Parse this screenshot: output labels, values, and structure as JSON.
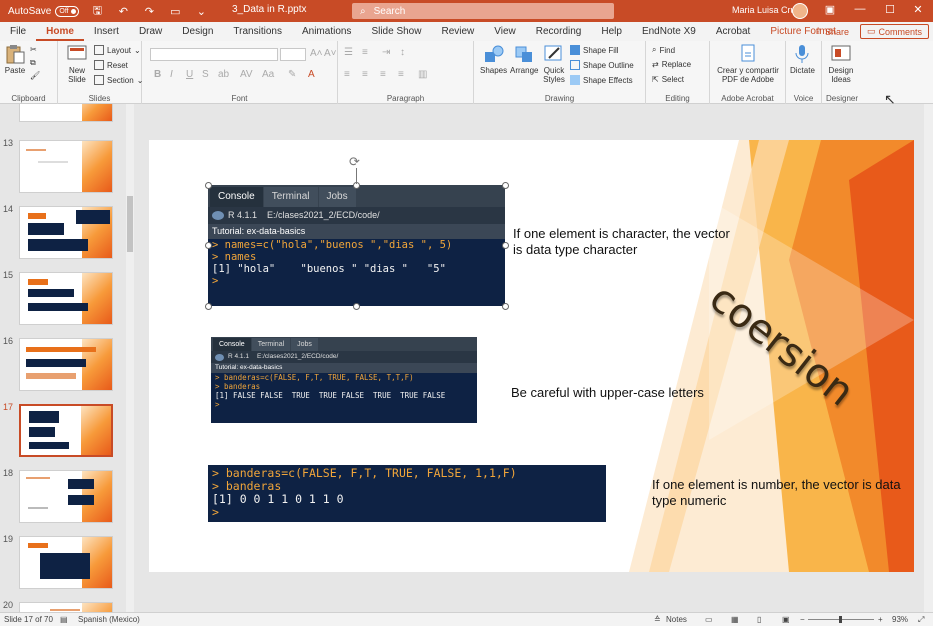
{
  "titlebar": {
    "autosave_label": "AutoSave",
    "autosave_state": "Off",
    "doc_name": "3_Data in R.pptx",
    "search_placeholder": "Search",
    "user_name": "Maria Luisa Cruz",
    "bg_color": "#c84b26"
  },
  "menu": {
    "tabs": [
      "File",
      "Home",
      "Insert",
      "Draw",
      "Design",
      "Transitions",
      "Animations",
      "Slide Show",
      "Review",
      "View",
      "Recording",
      "Help",
      "EndNote X9",
      "Acrobat",
      "Picture Format"
    ],
    "active": "Home",
    "share_label": "Share",
    "comments_label": "Comments"
  },
  "ribbon": {
    "clipboard": {
      "paste": "Paste",
      "label": "Clipboard"
    },
    "slides": {
      "new_slide": "New Slide",
      "layout": "Layout",
      "reset": "Reset",
      "section": "Section",
      "label": "Slides"
    },
    "font": {
      "label": "Font"
    },
    "paragraph": {
      "label": "Paragraph"
    },
    "drawing": {
      "shapes": "Shapes",
      "arrange": "Arrange",
      "quick_styles": "Quick Styles",
      "shape_fill": "Shape Fill",
      "shape_outline": "Shape Outline",
      "shape_effects": "Shape Effects",
      "label": "Drawing"
    },
    "editing": {
      "find": "Find",
      "replace": "Replace",
      "select": "Select",
      "label": "Editing"
    },
    "acrobat": {
      "create_pdf": "Crear y compartir PDF de Adobe",
      "label": "Adobe Acrobat"
    },
    "voice": {
      "dictate": "Dictate",
      "label": "Voice"
    },
    "designer": {
      "design_ideas": "Design Ideas",
      "label": "Designer"
    }
  },
  "thumbnails": {
    "numbers": [
      "13",
      "14",
      "15",
      "16",
      "17",
      "18",
      "19",
      "20"
    ],
    "selected": "17"
  },
  "slide": {
    "console1": {
      "tabs": [
        "Console",
        "Terminal",
        "Jobs"
      ],
      "r_version": "R 4.1.1",
      "path": "E:/clases2021_2/ECD/code/",
      "tutorial": "Tutorial: ex-data-basics",
      "lines": [
        {
          "prompt": "> ",
          "text": "names=c(\"hola\",\"buenos \",\"dias \", 5)"
        },
        {
          "prompt": "> ",
          "text": "names"
        },
        {
          "prompt": "",
          "text": "[1] \"hola\"    \"buenos \" \"dias \"   \"5\""
        },
        {
          "prompt": "> ",
          "text": ""
        }
      ]
    },
    "text1": "If one element is character, the vector is data type character",
    "console2": {
      "tabs": [
        "Console",
        "Terminal",
        "Jobs"
      ],
      "r_version": "R 4.1.1",
      "path": "E:/clases2021_2/ECD/code/",
      "tutorial": "Tutorial: ex-data-basics",
      "lines": [
        {
          "prompt": "> ",
          "text": "banderas=c(FALSE, F,T, TRUE, FALSE, T,T,F)"
        },
        {
          "prompt": "> ",
          "text": "banderas"
        },
        {
          "prompt": "",
          "text": "[1] FALSE FALSE  TRUE  TRUE FALSE  TRUE  TRUE FALSE"
        },
        {
          "prompt": "> ",
          "text": ""
        }
      ]
    },
    "text2": "Be careful with upper-case letters",
    "console3": {
      "lines": [
        {
          "prompt": "> ",
          "text": "banderas=c(FALSE, F,T, TRUE, FALSE, 1,1,F)"
        },
        {
          "prompt": "> ",
          "text": "banderas"
        },
        {
          "prompt": "",
          "text": "[1] 0 0 1 1 0 1 1 0"
        },
        {
          "prompt": "> ",
          "text": ""
        }
      ]
    },
    "text3": "If one element is number, the vector is data type numeric",
    "wordart": "coersion"
  },
  "statusbar": {
    "slide_of": "Slide 17 of 70",
    "language": "Spanish (Mexico)",
    "notes": "Notes",
    "zoom": "93%"
  },
  "colors": {
    "accent": "#c84b26",
    "console_bg": "#0e2244",
    "prompt": "#f0a53a",
    "orange_dark": "#e85a1a",
    "orange_light": "#f7b04a"
  }
}
